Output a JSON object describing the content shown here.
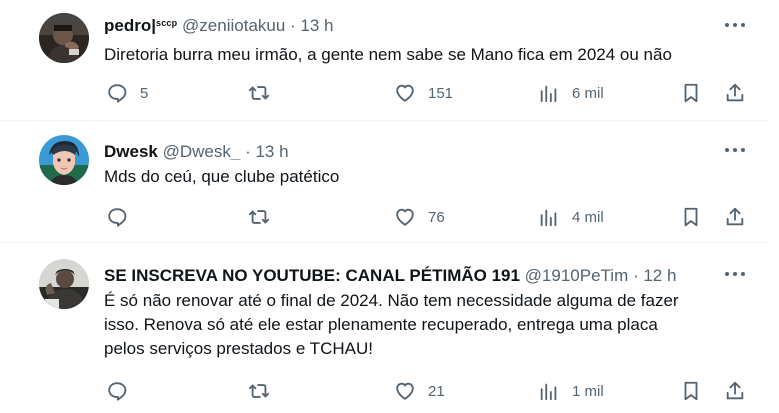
{
  "tweets": [
    {
      "name": "pedro|",
      "badge": "sccp",
      "handle": "@zeniiotakuu",
      "dot": " · ",
      "time": "13 h",
      "text": "Diretoria burra meu irmão, a gente nem sabe se Mano fica em 2024 ou não",
      "replies": "5",
      "retweets": "",
      "likes": "151",
      "views": "6 mil"
    },
    {
      "name": "Dwesk",
      "badge": "",
      "handle": "@Dwesk_",
      "dot": " · ",
      "time": "13 h",
      "text": "Mds do ceú, que clube patético",
      "replies": "",
      "retweets": "",
      "likes": "76",
      "views": "4 mil"
    },
    {
      "name": "SE INSCREVA NO YOUTUBE: CANAL PÉTIMÃO 191",
      "badge": "",
      "handle": "@1910PeTim",
      "dot": " · ",
      "time": "12 h",
      "text": "É só não renovar até o final de 2024. Não tem necessidade alguma de fazer\nisso. Renova só até ele estar plenamente recuperado, entrega uma placa\npelos serviços prestados e TCHAU!",
      "replies": "",
      "retweets": "",
      "likes": "21",
      "views": "1 mil"
    }
  ],
  "icons": {
    "reply": "reply-icon",
    "retweet": "retweet-icon",
    "like": "heart-icon",
    "views": "views-chart-icon",
    "bookmark": "bookmark-icon",
    "share": "share-icon",
    "more": "more-dots-icon"
  },
  "colors": {
    "text": "#0f1419",
    "secondary": "#536471",
    "divider": "#eff3f4"
  }
}
